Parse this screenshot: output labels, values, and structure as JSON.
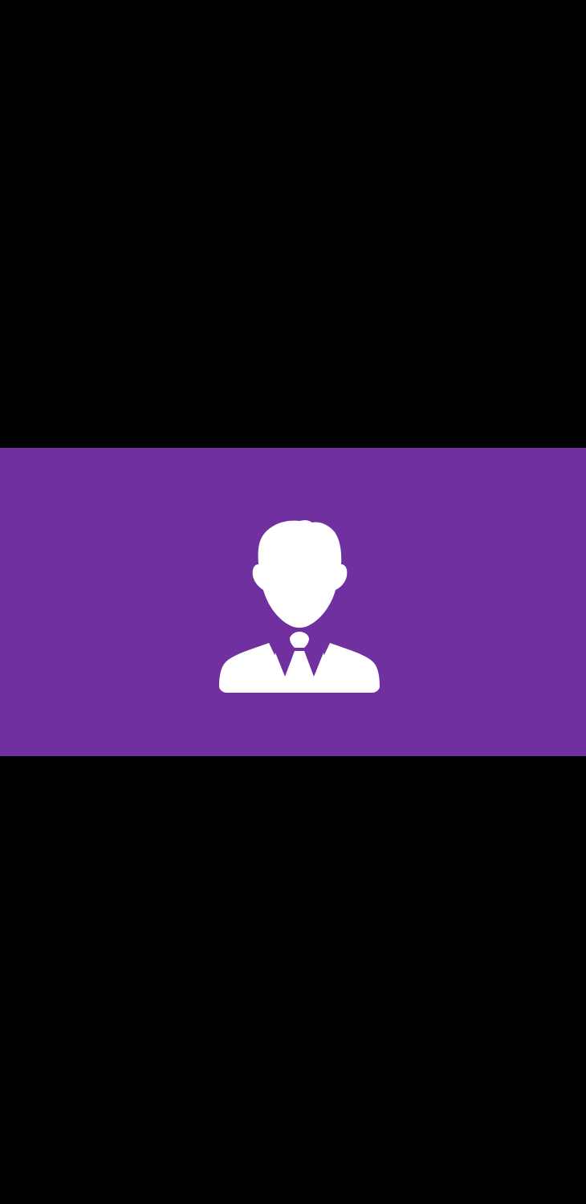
{
  "colors": {
    "background": "#000000",
    "banner": "#7030a0",
    "icon": "#ffffff"
  },
  "banner": {
    "icon": "businessman-avatar-icon"
  }
}
